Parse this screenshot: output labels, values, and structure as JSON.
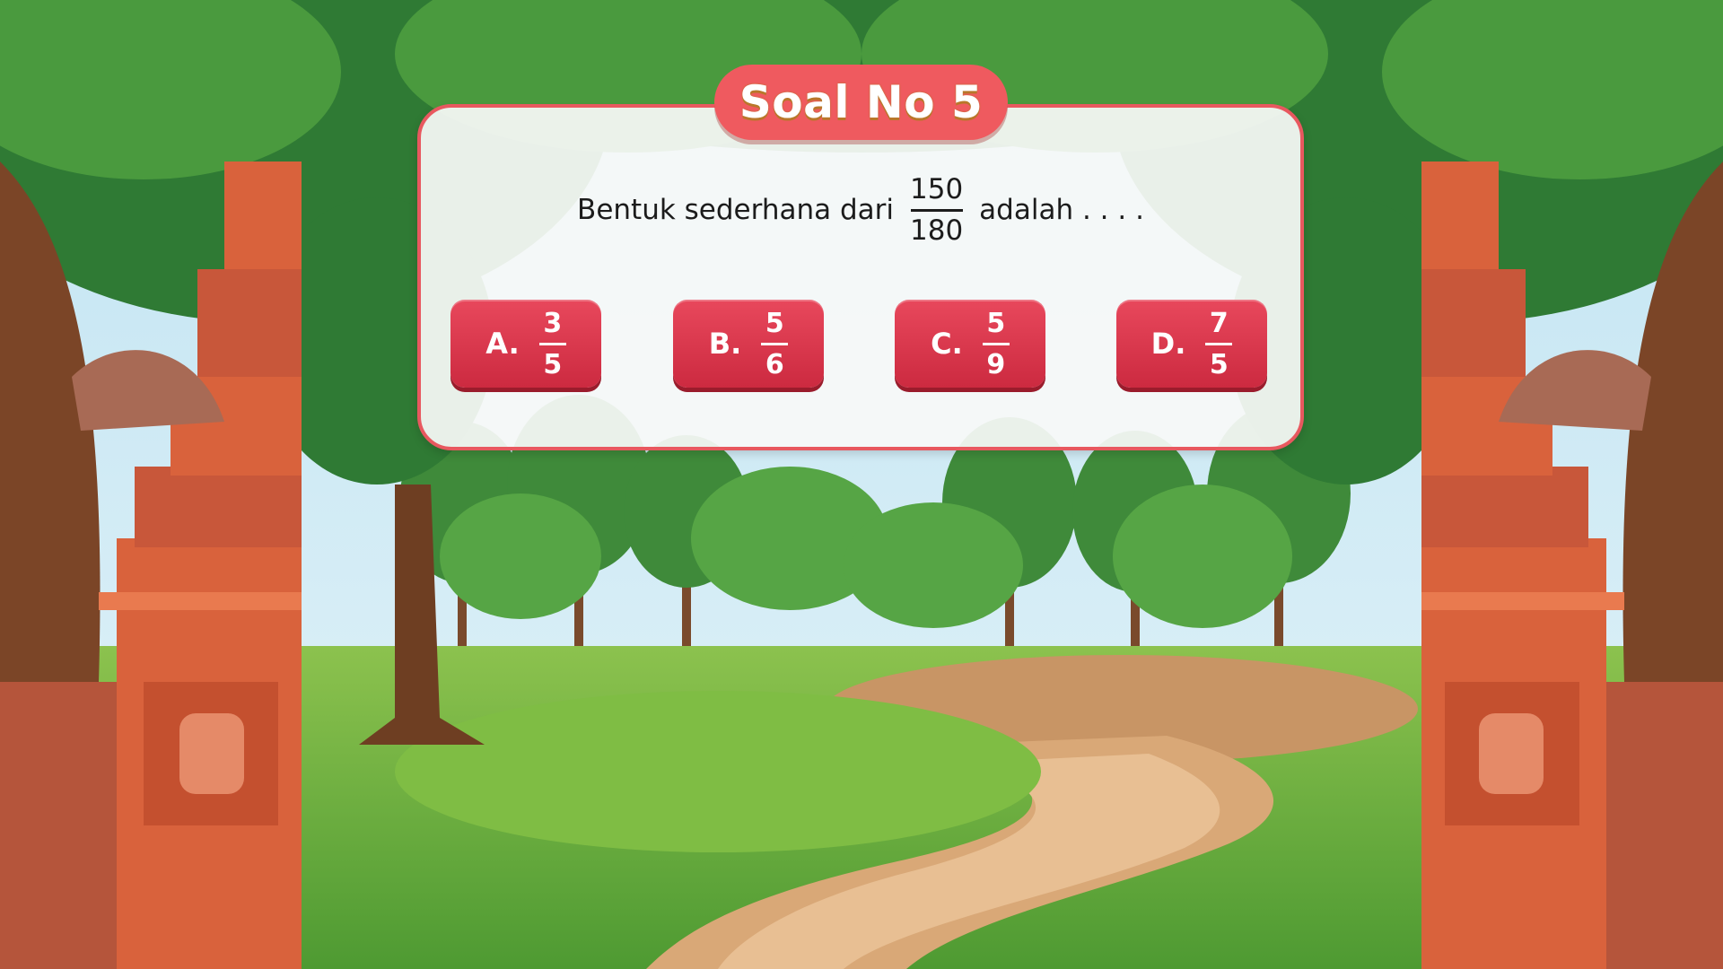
{
  "header": {
    "title": "Soal No 5"
  },
  "question": {
    "prefix": "Bentuk sederhana dari",
    "numerator": "150",
    "denominator": "180",
    "suffix": "adalah . . . ."
  },
  "options": [
    {
      "letter": "A.",
      "numerator": "3",
      "denominator": "5"
    },
    {
      "letter": "B.",
      "numerator": "5",
      "denominator": "6"
    },
    {
      "letter": "C.",
      "numerator": "5",
      "denominator": "9"
    },
    {
      "letter": "D.",
      "numerator": "7",
      "denominator": "5"
    }
  ],
  "colors": {
    "accent": "#ef5a5f",
    "option_button": "#d83248",
    "panel": "#f8f9f7"
  }
}
